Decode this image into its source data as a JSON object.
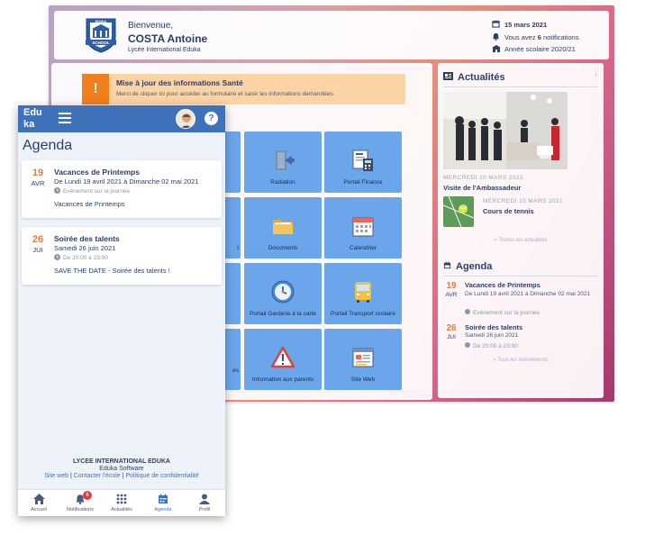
{
  "desktop": {
    "header": {
      "welcome": "Bienvenue,",
      "user_name": "COSTA Antoine",
      "school_name": "Lycée International Eduka",
      "logo_text_top": "EDUKA",
      "logo_text_bottom": "SCHOOL",
      "date": "15 mars 2021",
      "notifications_prefix": "Vous avez ",
      "notifications_count": "6",
      "notifications_suffix": " notifications",
      "school_year": "Année scolaire 2020/21"
    },
    "alert": {
      "icon": "!",
      "title": "Mise à jour des informations Santé",
      "text": "Merci de cliquer ici pour accéder au formulaire et saisir les informations demandées."
    },
    "tiles": [
      {
        "label": "Radiation",
        "icon": "exit-door-icon"
      },
      {
        "label": "Portail Finance",
        "icon": "invoice-calculator-icon"
      },
      {
        "label": "Documents",
        "icon": "folder-icon"
      },
      {
        "label": "Calendrier",
        "icon": "calendar-icon"
      },
      {
        "label": "Portail Garderie à la carte",
        "icon": "clock-icon"
      },
      {
        "label": "Portail Transport scolaire",
        "icon": "school-bus-icon"
      },
      {
        "label": "Information aux parents",
        "icon": "warning-icon"
      },
      {
        "label": "Site Web",
        "icon": "website-icon"
      }
    ],
    "partial_tile_labels": [
      "t",
      "es"
    ],
    "sidebar": {
      "news_heading": "Actualités",
      "news": [
        {
          "date": "MERCREDI 10 MARS 2021",
          "title": "Visite de l'Ambassadeur"
        },
        {
          "date": "MERCREDI 10 MARS 2021",
          "title": "Cours de tennis"
        }
      ],
      "all_news": "« Toutes les actualités",
      "agenda_heading": "Agenda",
      "events": [
        {
          "day": "19",
          "month": "AVR",
          "title": "Vacances de Printemps",
          "dates": "De Lundi 19 avril 2021 à Dimanche 02 mai 2021",
          "sub": "Evénement sur la journée"
        },
        {
          "day": "26",
          "month": "JUI",
          "title": "Soirée des talents",
          "dates": "Samedi 26 juin 2021",
          "sub": "De 20:00 à 23:00"
        }
      ],
      "all_events": "« Tous les événements"
    }
  },
  "mobile": {
    "logo_line1": "Edu",
    "logo_line2": "ka",
    "help": "?",
    "title": "Agenda",
    "events": [
      {
        "day": "19",
        "month": "AVR",
        "title": "Vacances de Printemps",
        "dates": "De Lundi 19 avril 2021 à Dimanche 02 mai 2021",
        "sub": "Evénement sur la journée",
        "description": "Vacances de Printemps"
      },
      {
        "day": "26",
        "month": "JUI",
        "title": "Soirée des talents",
        "dates": "Samedi 26 juin 2021",
        "sub": "De 20:00 à 23:00",
        "description": "SAVE THE DATE - Soirée des talents !"
      }
    ],
    "footer": {
      "school": "LYCEE INTERNATIONAL EDUKA",
      "company": "Eduka Software",
      "link_site": "Site web",
      "sep1": " | ",
      "link_contact": "Contacter l'école",
      "sep2": " | ",
      "link_privacy": "Politique de confidentialité"
    },
    "nav": [
      {
        "label": "Accueil",
        "icon": "home-icon"
      },
      {
        "label": "Notifications",
        "icon": "bell-icon",
        "badge": "6"
      },
      {
        "label": "Actualités",
        "icon": "grid-dots-icon"
      },
      {
        "label": "Agenda",
        "icon": "calendar-icon"
      },
      {
        "label": "Profil",
        "icon": "user-icon"
      }
    ]
  },
  "colors": {
    "accent": "#3f72b9",
    "tile": "#6ca6ea",
    "date_orange": "#e37a4c",
    "alert_bg": "#fbd3a4",
    "alert_icon": "#f07f1c",
    "badge": "#e23b3b"
  }
}
